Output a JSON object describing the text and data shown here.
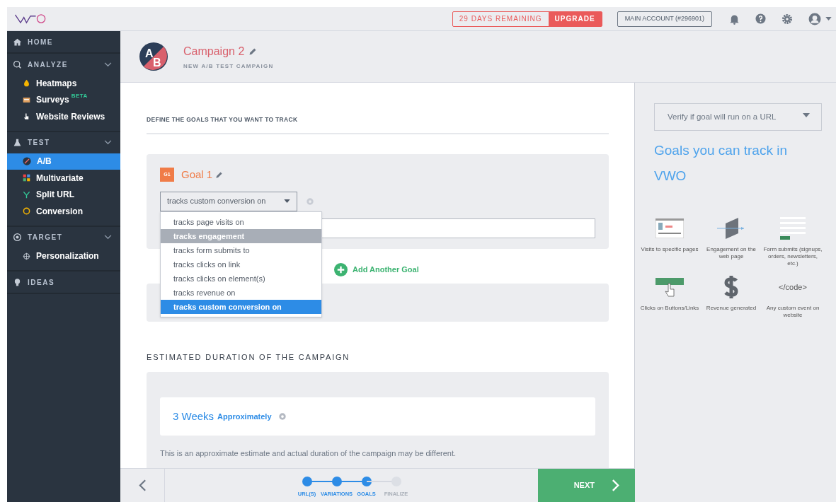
{
  "topbar": {
    "trial": "29 DAYS REMAINING",
    "upgrade": "UPGRADE",
    "account": "MAIN ACCOUNT (#296901)"
  },
  "sidebar": [
    {
      "kind": "link",
      "label": "HOME"
    },
    {
      "kind": "section",
      "label": "ANALYZE",
      "expanded": true,
      "items": [
        {
          "label": "Heatmaps",
          "selected": false
        },
        {
          "label": "Surveys",
          "badge": "BETA",
          "selected": false
        },
        {
          "label": "Website Reviews",
          "selected": false
        }
      ]
    },
    {
      "kind": "section",
      "label": "TEST",
      "expanded": true,
      "items": [
        {
          "label": "A/B",
          "selected": true
        },
        {
          "label": "Multivariate",
          "selected": false
        },
        {
          "label": "Split URL",
          "selected": false
        },
        {
          "label": "Conversion",
          "selected": false
        }
      ]
    },
    {
      "kind": "section",
      "label": "TARGET",
      "expanded": true,
      "items": [
        {
          "label": "Personalization",
          "selected": false
        }
      ]
    },
    {
      "kind": "link",
      "label": "IDEAS"
    }
  ],
  "header": {
    "avatar_a": "A",
    "avatar_b": "B",
    "title": "Campaign 2",
    "subtitle": "NEW A/B TEST CAMPAIGN"
  },
  "goals_section": {
    "title": "DEFINE THE GOALS THAT YOU WANT TO TRACK",
    "goal": {
      "badge": "G1",
      "title": "Goal 1",
      "select_value": "tracks custom conversion on",
      "menu": [
        {
          "label": "tracks page visits on",
          "selected": false,
          "hovered": false
        },
        {
          "label": "tracks engagement",
          "selected": false,
          "hovered": true
        },
        {
          "label": "tracks form submits to",
          "selected": false,
          "hovered": false
        },
        {
          "label": "tracks clicks on link",
          "selected": false,
          "hovered": false
        },
        {
          "label": "tracks clicks on element(s)",
          "selected": false,
          "hovered": false
        },
        {
          "label": "tracks revenue on",
          "selected": false,
          "hovered": false
        },
        {
          "label": "tracks custom conversion on",
          "selected": true,
          "hovered": false
        }
      ]
    },
    "add_goal": "Add Another Goal"
  },
  "duration": {
    "title": "ESTIMATED DURATION OF THE CAMPAIGN",
    "value": "3 Weeks",
    "qualifier": "Approximately",
    "note": "This is an approximate estimate and actual duration of the campaign may be different."
  },
  "footer": {
    "steps": [
      {
        "label": "URL(S)",
        "done": true
      },
      {
        "label": "VARIATIONS",
        "done": true
      },
      {
        "label": "GOALS",
        "done": true
      },
      {
        "label": "FINALIZE",
        "done": false
      }
    ],
    "next": "NEXT"
  },
  "right_panel": {
    "verify": "Verify if goal will run on a URL",
    "heading": "Goals you can track in VWO",
    "tiles": [
      {
        "kind": "pages",
        "caption": "Visits to specific pages"
      },
      {
        "kind": "engagement",
        "caption": "Engagement on the web page"
      },
      {
        "kind": "form",
        "caption": "Form submits (signups, orders, newsletters, etc.)"
      },
      {
        "kind": "click",
        "caption": "Clicks on Buttons/Links"
      },
      {
        "kind": "revenue",
        "caption": "Revenue generated"
      },
      {
        "kind": "code",
        "caption": "Any custom event on website",
        "code": "</code>"
      }
    ]
  }
}
